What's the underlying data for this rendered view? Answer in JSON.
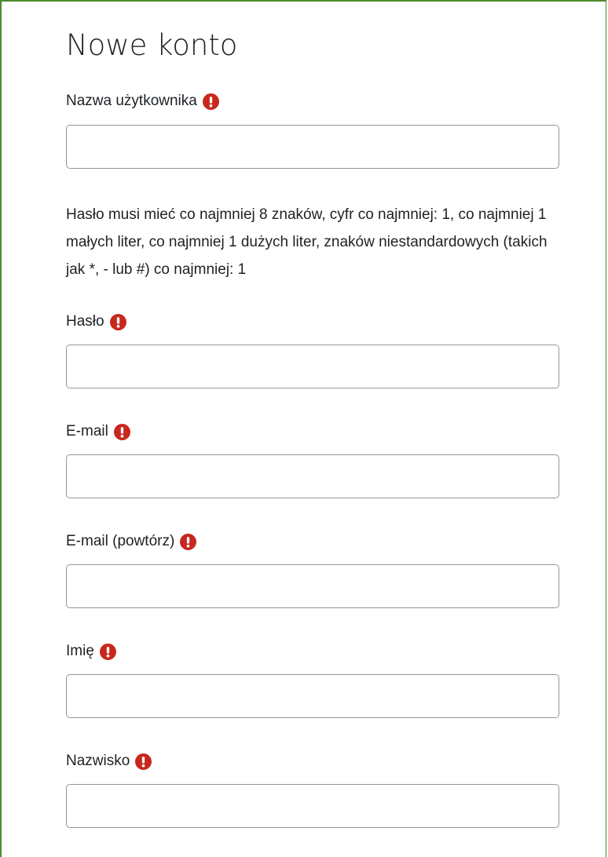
{
  "page": {
    "title": "Nowe konto"
  },
  "form": {
    "username": {
      "label": "Nazwa użytkownika",
      "value": "",
      "placeholder": ""
    },
    "password_hint": "Hasło musi mieć co najmniej 8 znaków, cyfr co najmniej: 1, co najmniej 1 małych liter, co najmniej 1 dużych liter, znaków niestandardowych (takich jak *, - lub #) co najmniej: 1",
    "password": {
      "label": "Hasło",
      "value": "",
      "placeholder": ""
    },
    "email": {
      "label": "E-mail",
      "value": "",
      "placeholder": ""
    },
    "email_repeat": {
      "label": "E-mail (powtórz)",
      "value": "",
      "placeholder": ""
    },
    "first_name": {
      "label": "Imię",
      "value": "",
      "placeholder": ""
    },
    "last_name": {
      "label": "Nazwisko",
      "value": "",
      "placeholder": ""
    }
  },
  "icons": {
    "required": "exclamation-circle-icon"
  },
  "colors": {
    "frame_border": "#4e8a2c",
    "required_icon": "#c8271e",
    "text": "#1d2125",
    "input_border": "#8f959e"
  }
}
